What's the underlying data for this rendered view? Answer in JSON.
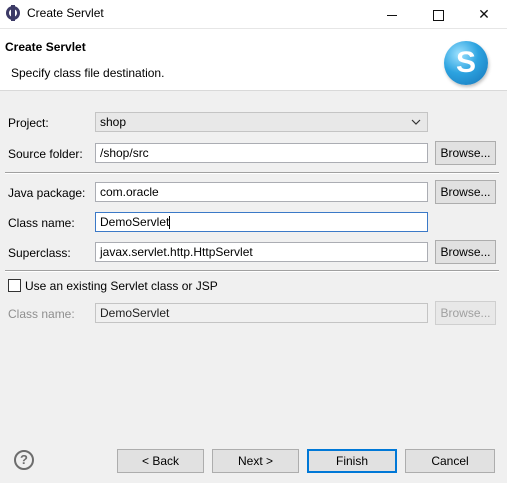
{
  "window": {
    "title": "Create Servlet",
    "icon": "eclipse-icon",
    "controls": {
      "minimize": "minimize-icon",
      "maximize": "maximize-icon",
      "close": "✕"
    }
  },
  "banner": {
    "title": "Create Servlet",
    "description": "Specify class file destination.",
    "logo_letter": "S",
    "logo_color": "#2ca3e0"
  },
  "form": {
    "project": {
      "label": "Project:",
      "value": "shop"
    },
    "source_folder": {
      "label": "Source folder:",
      "value": "/shop/src",
      "browse": "Browse..."
    },
    "java_package": {
      "label": "Java package:",
      "value": "com.oracle",
      "browse": "Browse..."
    },
    "class_name": {
      "label": "Class name:",
      "value": "DemoServlet"
    },
    "superclass": {
      "label": "Superclass:",
      "value": "javax.servlet.http.HttpServlet",
      "browse": "Browse..."
    },
    "use_existing": {
      "label": "Use an existing Servlet class or JSP",
      "checked": false
    },
    "existing_class_name": {
      "label": "Class name:",
      "value": "DemoServlet",
      "browse": "Browse..."
    }
  },
  "footer": {
    "help_glyph": "?",
    "back": "< Back",
    "next": "Next >",
    "finish": "Finish",
    "cancel": "Cancel"
  }
}
